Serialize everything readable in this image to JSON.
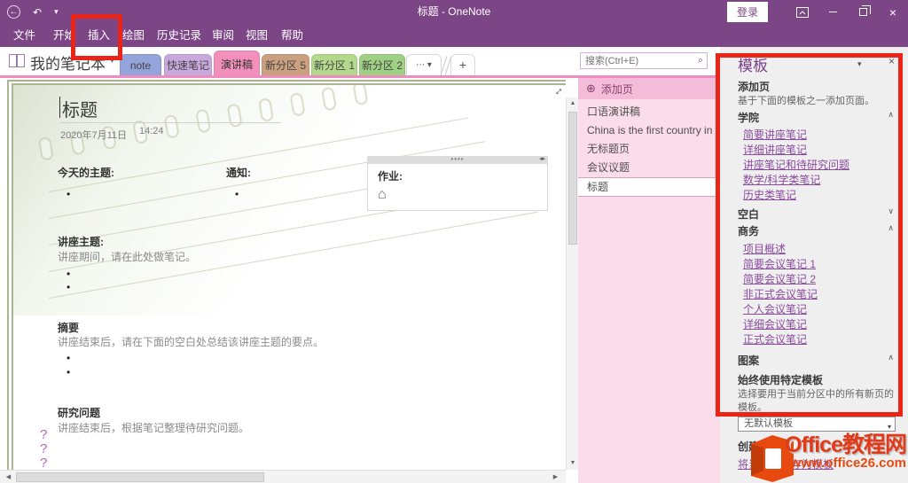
{
  "window": {
    "title": "标题  -  OneNote",
    "login": "登录"
  },
  "menu": {
    "items": [
      "文件",
      "开始",
      "插入",
      "绘图",
      "历史记录",
      "审阅",
      "视图",
      "帮助"
    ]
  },
  "nav": {
    "notebook": "我的笔记本",
    "sections": [
      {
        "label": "note",
        "color": "#94a3d9"
      },
      {
        "label": "快速笔记",
        "color": "#c9a9dd"
      },
      {
        "label": "演讲稿",
        "color": "#f290bb"
      },
      {
        "label": "新分区 5",
        "color": "#cba07f"
      },
      {
        "label": "新分区 1",
        "color": "#b4d98c"
      },
      {
        "label": "新分区 2",
        "color": "#9ed184"
      }
    ],
    "more": "⋯",
    "add": "+"
  },
  "search": {
    "placeholder": "搜索(Ctrl+E)"
  },
  "editor": {
    "title": "标题",
    "date": "2020年7月11日",
    "time": "14:24",
    "today_label": "今天的主题:",
    "notice_label": "通知:",
    "homework_label": "作业:",
    "lecture_label": "讲座主题:",
    "lecture_hint": "讲座期间，请在此处做笔记。",
    "summary_label": "摘要",
    "summary_hint": "讲座结束后，请在下面的空白处总结该讲座主题的要点。",
    "research_label": "研究问题",
    "research_hint": "讲座结束后，根据笔记整理待研究问题。",
    "question_marks": [
      "?",
      "?",
      "?",
      "?"
    ]
  },
  "pages": {
    "add_label": "添加页",
    "items": [
      "口语演讲稿",
      "China is the first country in the",
      "无标题页",
      "会议议题",
      "标题"
    ]
  },
  "templates": {
    "title": "模板",
    "section_add": "添加页",
    "add_desc": "基于下面的模板之一添加页面。",
    "group_academic": "学院",
    "academic_items": [
      "简要讲座笔记",
      "详细讲座笔记",
      "讲座笔记和待研究问题",
      "数学/科学类笔记",
      "历史类笔记"
    ],
    "group_blank": "空白",
    "group_business": "商务",
    "business_items": [
      "项目概述",
      "简要会议笔记 1",
      "简要会议笔记 2",
      "非正式会议笔记",
      "个人会议笔记",
      "详细会议笔记",
      "正式会议笔记"
    ],
    "group_decorative": "图案",
    "always_heading": "始终使用特定模板",
    "always_desc": "选择要用于当前分区中的所有新页的模板。",
    "default_value": "无默认模板",
    "create_heading": "创建新模板",
    "create_link": "将当前页另存为模板"
  },
  "watermark": {
    "brand": "Office教程网",
    "url": "www.office26.com"
  },
  "colors": {
    "titlebar": "#7c4586",
    "active_section_pink": "#f290bb",
    "pages_panel_pink": "#fbdcea",
    "link_purple": "#8a4a9d",
    "highlight_red": "#ea2517",
    "watermark_orange": "#e8490f"
  }
}
